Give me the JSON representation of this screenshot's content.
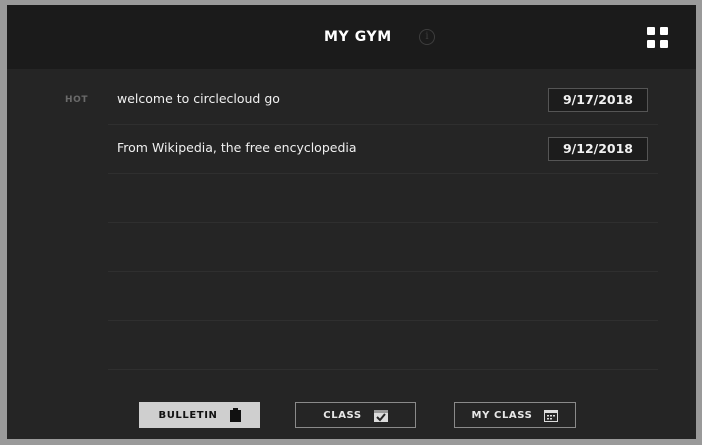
{
  "header": {
    "title": "MY GYM",
    "info_icon": "info-icon",
    "menu_icon": "grid-icon"
  },
  "bulletins": [
    {
      "tag": "HOT",
      "title": "welcome to circlecloud go",
      "date": "9/17/2018"
    },
    {
      "tag": "",
      "title": "From Wikipedia, the free encyclopedia",
      "date": "9/12/2018"
    }
  ],
  "nav": {
    "bulletin": {
      "label": "BULLETIN",
      "icon": "clipboard-icon",
      "active": true
    },
    "class": {
      "label": "CLASS",
      "icon": "calendar-check-icon"
    },
    "my_class": {
      "label": "MY CLASS",
      "icon": "calendar-icon"
    }
  },
  "colors": {
    "background": "#252525",
    "header": "#1b1b1b",
    "active_tab": "#cfcfcf"
  }
}
